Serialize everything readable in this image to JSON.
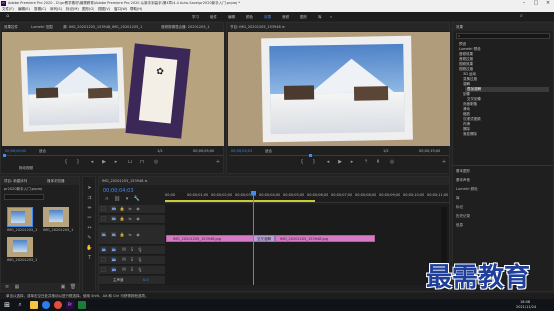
{
  "titlebar": {
    "title": "Adobe Premiere Pro 2020 - D:\\pr教学素材\\最需教育\\Adobe Premiere Pro 2020 从新手到高手\\第4章\\4.4 Auto-Save\\pr2020新手入门.prproj *"
  },
  "menu": [
    "文件(F)",
    "编辑(E)",
    "剪辑(C)",
    "序列(S)",
    "标记(M)",
    "图形(G)",
    "视图(V)",
    "窗口(W)",
    "帮助(H)"
  ],
  "workspace_tabs": [
    "学习",
    "组件",
    "编辑",
    "颜色",
    "效果",
    "音频",
    "图形",
    "库",
    "»"
  ],
  "source_monitor": {
    "tabs": [
      "效果控件",
      "Lumetri 范围",
      "源: IMG_20201205_153948_IMG_20201205_1",
      "音频剪辑混合器: 20201205_1"
    ],
    "timecode_left": "00;00;00;00",
    "fit": "适合",
    "scale": "1/2",
    "timecode_right": "00;00;05;00",
    "bottom_note": "拖动视频"
  },
  "program_monitor": {
    "tabs": [
      "节目: IMG_20201205_153948 ≡"
    ],
    "timecode_left": "00;00;04;03",
    "fit": "适合",
    "scale": "1/2",
    "timecode_right": "00;00;15;00"
  },
  "effects_panel": {
    "title": "效果",
    "search_placeholder": "",
    "tree": [
      "预设",
      "Lumetri 预设",
      "音频效果",
      "音频过渡",
      "视频效果",
      "视频过渡",
      "3D 运动",
      "变换过渡",
      "溶解",
      "叠加溶解",
      "划像",
      "交叉划像",
      "页面剥落",
      "滑动",
      "缩放",
      "沉浸式视频",
      "内滑",
      "擦除",
      "渐变擦除"
    ],
    "sections": [
      "基本图形",
      "基本声音",
      "Lumetri 颜色",
      "库",
      "标记",
      "历史记录",
      "信息"
    ]
  },
  "project_panel": {
    "tabs": [
      "项目: 新建序列",
      "媒体浏览器"
    ],
    "file_name": "pr2020新手入门.prproj",
    "items": [
      {
        "name": "IMG_20201205_153948",
        "duration": "5;00"
      },
      {
        "name": "IMG_20201205_1",
        "duration": "5;00"
      },
      {
        "name": "IMG_20201205_15",
        "duration": "5;00"
      }
    ]
  },
  "timeline": {
    "tab": "IMG_20201205_153948 ≡",
    "timecode": "00;00;04;03",
    "ruler": [
      "00;00",
      "00;00;01;00",
      "00;00;02;00",
      "00;00;03;00",
      "00;00;04;00",
      "00;00;05;00",
      "00;00;06;00",
      "00;00;07;00",
      "00;00;08;00",
      "00;00;09;00",
      "00;00;10;00",
      "00;00;11;00"
    ],
    "tracks": [
      "V3",
      "V2",
      "V1",
      "A1",
      "A2",
      "A3"
    ],
    "master": "主声道",
    "master_value": "0.0",
    "clip1": "IMG_20201205_153948.jpg",
    "clip2": "IMG_20201205_153948.jpg",
    "transition": "交叉溶解"
  },
  "statusbar": {
    "text": "单击以选择，或单击空白处并拖动以进行框选择。使用 Shift、Alt 和 Ctrl 可获得其他选项。"
  },
  "taskbar": {
    "time": "18:08",
    "date": "2021/11/24"
  },
  "watermark": "最需教育",
  "colors": {
    "accent": "#3f8cf5",
    "clip": "#d77ac5",
    "playhead": "#3f8cf5"
  }
}
